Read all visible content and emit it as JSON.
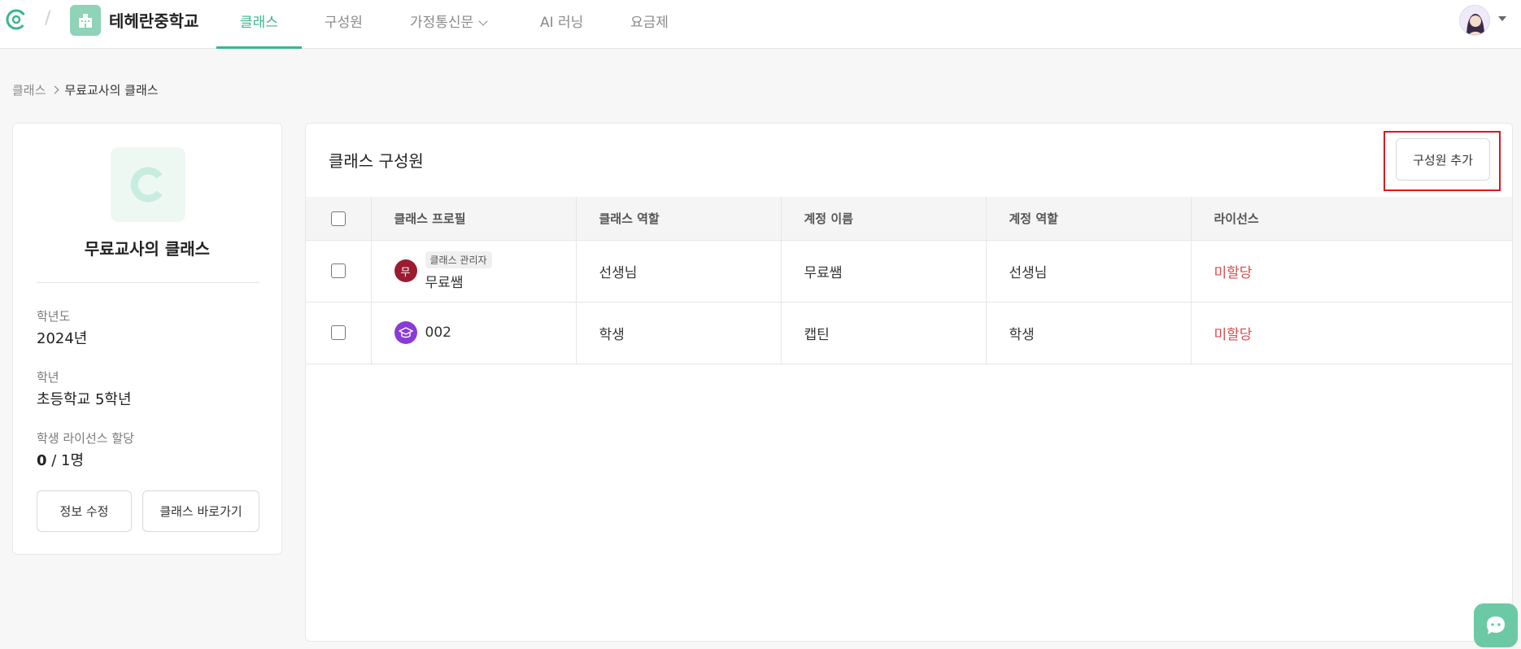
{
  "nav": {
    "school_name": "테헤란중학교",
    "items": [
      {
        "label": "클래스",
        "active": true
      },
      {
        "label": "구성원",
        "active": false
      },
      {
        "label": "가정통신문",
        "active": false,
        "dropdown": true
      },
      {
        "label": "AI 러닝",
        "active": false
      },
      {
        "label": "요금제",
        "active": false
      }
    ]
  },
  "breadcrumb": {
    "parent": "클래스",
    "current": "무료교사의 클래스"
  },
  "class_info": {
    "logo_letter": "C",
    "name": "무료교사의 클래스",
    "year_label": "학년도",
    "year_value": "2024년",
    "grade_label": "학년",
    "grade_value": "초등학교 5학년",
    "license_label": "학생 라이선스 할당",
    "license_assigned": "0",
    "license_total": " / 1명",
    "edit_button": "정보 수정",
    "goto_button": "클래스 바로가기"
  },
  "members": {
    "title": "클래스 구성원",
    "add_button": "구성원 추가",
    "columns": [
      "클래스 프로필",
      "클래스 역할",
      "계정 이름",
      "계정 역할",
      "라이선스"
    ],
    "rows": [
      {
        "avatar_text": "무",
        "avatar_color": "#9b1b30",
        "badge": "클래스 관리자",
        "name": "무료쌤",
        "class_role": "선생님",
        "account_name": "무료쌤",
        "account_role": "선생님",
        "license": "미할당"
      },
      {
        "avatar_text": "",
        "avatar_color": "#8a3ad6",
        "badge": "",
        "name": "002",
        "class_role": "학생",
        "account_name": "캡틴",
        "account_role": "학생",
        "license": "미할당"
      }
    ]
  },
  "colors": {
    "accent": "#3bb58d",
    "unassigned": "#d64c4c",
    "highlight": "#e0161c"
  }
}
